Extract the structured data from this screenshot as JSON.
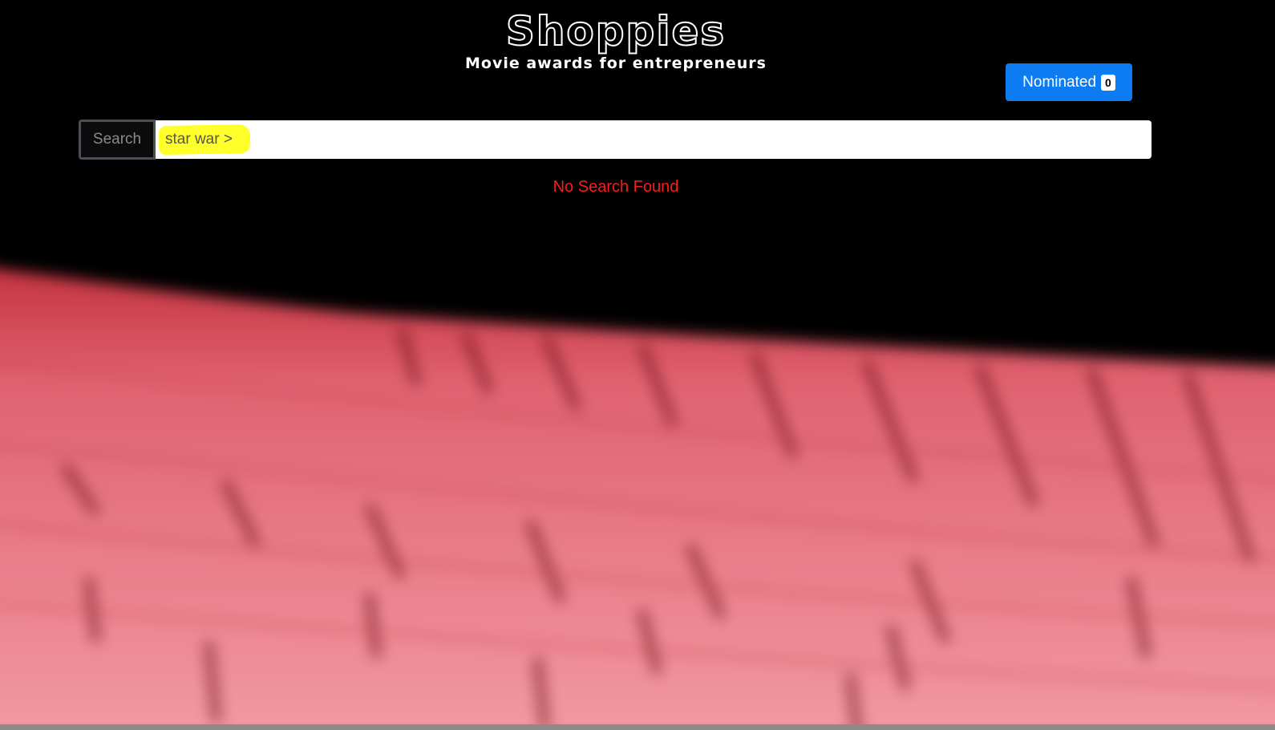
{
  "header": {
    "brand": "Shoppies",
    "tagline": "Movie awards for entrepreneurs"
  },
  "nominated_button": {
    "label": "Nominated",
    "count": "0"
  },
  "search": {
    "button_label": "Search",
    "value": "star war >",
    "placeholder": ""
  },
  "status": {
    "message": "No Search Found"
  },
  "colors": {
    "background": "#000000",
    "accent": "#0d7cf2",
    "error": "#ff1a1a",
    "highlight": "#ffff2a",
    "seats": "#e0606a"
  }
}
